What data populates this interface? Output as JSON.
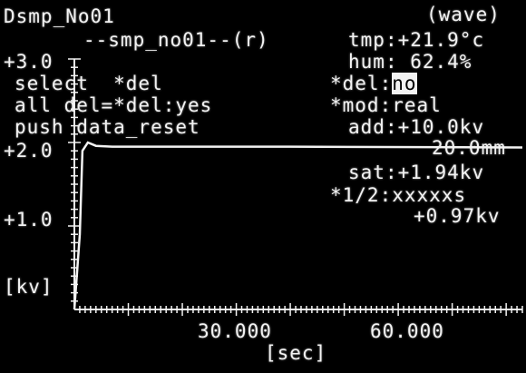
{
  "header": {
    "file_name": "Dsmp_No01",
    "mode": "(wave)",
    "sample_title": "--smp_no01--(r)"
  },
  "readings": {
    "tmp": {
      "label": "tmp",
      "value": "+21.9°c"
    },
    "hum": {
      "label": "hum",
      "value": " 62.4%"
    },
    "add": {
      "label": "add",
      "value": "+10.0kv"
    },
    "distance": "20.0mm",
    "sat": {
      "label": "sat",
      "value": "+1.94kv"
    },
    "half": {
      "label": "*1/2",
      "value": "xxxxxs"
    },
    "half_value": "+0.97kv"
  },
  "menu": {
    "select_line": "select  *del",
    "all_del_line": "all del=*del",
    "all_del_value": "yes",
    "push_line": "push data_reset",
    "del_label": "*del",
    "del_value": "no",
    "mod_label": "*mod",
    "mod_value": "real"
  },
  "chart_data": {
    "type": "line",
    "title": "",
    "xlabel": "[sec]",
    "ylabel": "[kv]",
    "xlim": [
      0,
      83
    ],
    "ylim": [
      0,
      3.0
    ],
    "y_tick_labels": [
      "+3.0",
      "+2.0",
      "+1.0"
    ],
    "x_tick_labels": [
      "30.000",
      "60.000"
    ],
    "series": [
      {
        "x": [
          0,
          1.0,
          1.5,
          2.5,
          4,
          7,
          40,
          90
        ],
        "y": [
          0,
          0.9,
          1.9,
          2.0,
          1.96,
          1.95,
          1.95,
          1.94
        ]
      }
    ],
    "grid": false
  },
  "colors": {
    "background": "#000000",
    "foreground": "#f2f2f2"
  }
}
